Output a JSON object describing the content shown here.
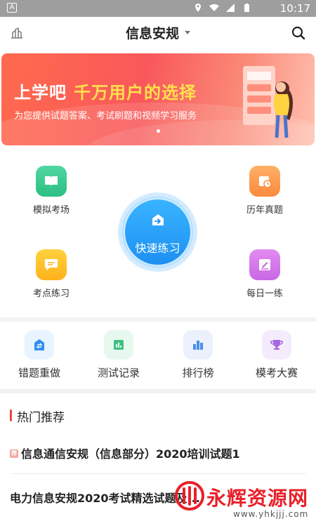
{
  "status_bar": {
    "time": "10:17",
    "left_badge": "A"
  },
  "header": {
    "title": "信息安规"
  },
  "banner": {
    "headline_part1": "上学吧",
    "headline_part2": "千万用户的选择",
    "subtitle": "为您提供试题答案、考试刷题和视频学习服务"
  },
  "features": {
    "mock_exam": "模拟考场",
    "past_exams": "历年真题",
    "quick_practice": "快速练习",
    "key_points": "考点练习",
    "daily": "每日一练"
  },
  "secondary": [
    {
      "label": "错题重做",
      "icon": "redo-icon"
    },
    {
      "label": "测试记录",
      "icon": "chart-icon"
    },
    {
      "label": "排行榜",
      "icon": "ranking-icon"
    },
    {
      "label": "模考大赛",
      "icon": "trophy-icon"
    }
  ],
  "hot": {
    "title": "热门推荐",
    "items": [
      {
        "tag": "荐",
        "text": "信息通信安规（信息部分）2020培训试题1"
      },
      {
        "text": "电力信息安规2020考试精选试题及..."
      }
    ]
  },
  "watermark": {
    "name": "永辉资源网",
    "url": "www.yhkjjj.com"
  },
  "colors": {
    "accent": "#1e8ff2",
    "banner": "#f9585a",
    "hot_bar": "#f0433b"
  }
}
